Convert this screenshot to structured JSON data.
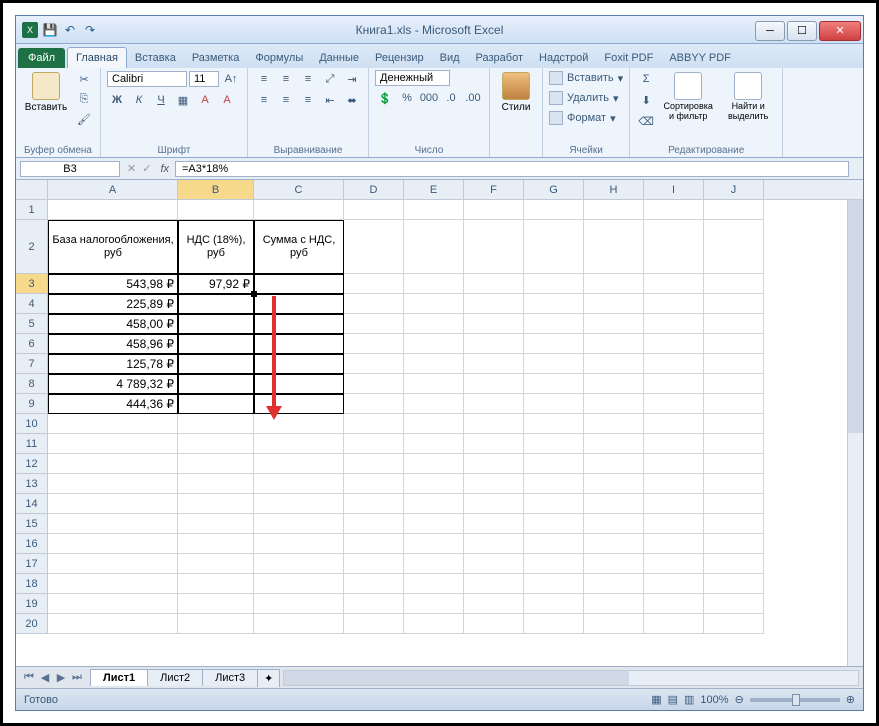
{
  "title": "Книга1.xls  -  Microsoft Excel",
  "tabs": {
    "file": "Файл",
    "list": [
      "Главная",
      "Вставка",
      "Разметка",
      "Формулы",
      "Данные",
      "Рецензир",
      "Вид",
      "Разработ",
      "Надстрой",
      "Foxit PDF",
      "ABBYY PDF"
    ],
    "active": 0
  },
  "ribbon": {
    "clipboard": {
      "label": "Буфер обмена",
      "paste": "Вставить"
    },
    "font": {
      "label": "Шрифт",
      "name": "Calibri",
      "size": "11"
    },
    "align": {
      "label": "Выравнивание"
    },
    "number": {
      "label": "Число",
      "format": "Денежный"
    },
    "styles": {
      "label": "Стили",
      "btn": "Стили"
    },
    "cells": {
      "label": "Ячейки",
      "insert": "Вставить",
      "delete": "Удалить",
      "format": "Формат"
    },
    "editing": {
      "label": "Редактирование",
      "sort": "Сортировка и фильтр",
      "find": "Найти и выделить"
    }
  },
  "namebox": "B3",
  "formula": "=A3*18%",
  "columns": [
    "A",
    "B",
    "C",
    "D",
    "E",
    "F",
    "G",
    "H",
    "I",
    "J"
  ],
  "headers": {
    "A": "База налогообложения, руб",
    "B": "НДС (18%), руб",
    "C": "Сумма с НДС, руб"
  },
  "data": {
    "A3": "543,98 ₽",
    "B3": "97,92 ₽",
    "A4": "225,89 ₽",
    "A5": "458,00 ₽",
    "A6": "458,96 ₽",
    "A7": "125,78 ₽",
    "A8": "4 789,32 ₽",
    "A9": "444,36 ₽"
  },
  "sheets": [
    "Лист1",
    "Лист2",
    "Лист3"
  ],
  "status": "Готово",
  "zoom": "100%"
}
